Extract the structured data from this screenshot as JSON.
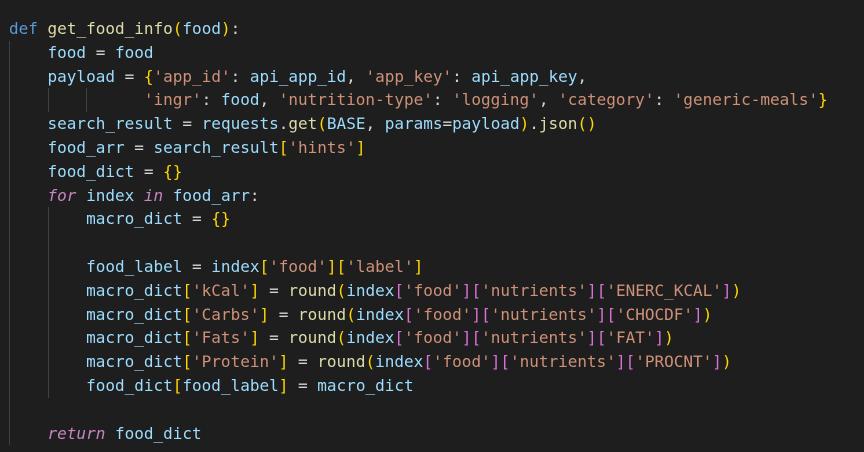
{
  "editor": {
    "theme_colors": {
      "background": "#1e1e1e",
      "keyword": "#569cd6",
      "control_keyword": "#c586c0",
      "function": "#dcdcaa",
      "variable": "#9cdcfe",
      "string": "#ce9178",
      "plain": "#d4d4d4",
      "bracket_level_1": "#ffd700",
      "bracket_level_2": "#da70d6",
      "bracket_level_3": "#179fff",
      "indent_guide": "#404040"
    },
    "lines": [
      {
        "indent": 0,
        "tokens": [
          {
            "t": "def",
            "c": "kw-def"
          },
          {
            "t": " ",
            "c": "pl"
          },
          {
            "t": "get_food_info",
            "c": "fn"
          },
          {
            "t": "(",
            "c": "br1"
          },
          {
            "t": "food",
            "c": "var"
          },
          {
            "t": ")",
            "c": "br1"
          },
          {
            "t": ":",
            "c": "pl"
          }
        ]
      },
      {
        "indent": 1,
        "tokens": [
          {
            "t": "food",
            "c": "var"
          },
          {
            "t": " = ",
            "c": "pl"
          },
          {
            "t": "food",
            "c": "var"
          }
        ]
      },
      {
        "indent": 1,
        "tokens": [
          {
            "t": "payload",
            "c": "var"
          },
          {
            "t": " = ",
            "c": "pl"
          },
          {
            "t": "{",
            "c": "br1"
          },
          {
            "t": "'app_id'",
            "c": "str"
          },
          {
            "t": ": ",
            "c": "pl"
          },
          {
            "t": "api_app_id",
            "c": "var"
          },
          {
            "t": ", ",
            "c": "pl"
          },
          {
            "t": "'app_key'",
            "c": "str"
          },
          {
            "t": ": ",
            "c": "pl"
          },
          {
            "t": "api_app_key",
            "c": "var"
          },
          {
            "t": ",",
            "c": "pl"
          }
        ]
      },
      {
        "indent": 3,
        "pad": "  ",
        "tokens": [
          {
            "t": "'ingr'",
            "c": "str"
          },
          {
            "t": ": ",
            "c": "pl"
          },
          {
            "t": "food",
            "c": "var"
          },
          {
            "t": ", ",
            "c": "pl"
          },
          {
            "t": "'nutrition-type'",
            "c": "str"
          },
          {
            "t": ": ",
            "c": "pl"
          },
          {
            "t": "'logging'",
            "c": "str"
          },
          {
            "t": ", ",
            "c": "pl"
          },
          {
            "t": "'category'",
            "c": "str"
          },
          {
            "t": ": ",
            "c": "pl"
          },
          {
            "t": "'generic-meals'",
            "c": "str"
          },
          {
            "t": "}",
            "c": "br1"
          }
        ]
      },
      {
        "indent": 1,
        "tokens": [
          {
            "t": "search_result",
            "c": "var"
          },
          {
            "t": " = ",
            "c": "pl"
          },
          {
            "t": "requests",
            "c": "var"
          },
          {
            "t": ".",
            "c": "pl"
          },
          {
            "t": "get",
            "c": "fn"
          },
          {
            "t": "(",
            "c": "br1"
          },
          {
            "t": "BASE",
            "c": "var"
          },
          {
            "t": ", ",
            "c": "pl"
          },
          {
            "t": "params",
            "c": "var"
          },
          {
            "t": "=",
            "c": "pl"
          },
          {
            "t": "payload",
            "c": "var"
          },
          {
            "t": ")",
            "c": "br1"
          },
          {
            "t": ".",
            "c": "pl"
          },
          {
            "t": "json",
            "c": "fn"
          },
          {
            "t": "(",
            "c": "br1"
          },
          {
            "t": ")",
            "c": "br1"
          }
        ]
      },
      {
        "indent": 1,
        "tokens": [
          {
            "t": "food_arr",
            "c": "var"
          },
          {
            "t": " = ",
            "c": "pl"
          },
          {
            "t": "search_result",
            "c": "var"
          },
          {
            "t": "[",
            "c": "br1"
          },
          {
            "t": "'hints'",
            "c": "str"
          },
          {
            "t": "]",
            "c": "br1"
          }
        ]
      },
      {
        "indent": 1,
        "tokens": [
          {
            "t": "food_dict",
            "c": "var"
          },
          {
            "t": " = ",
            "c": "pl"
          },
          {
            "t": "{}",
            "c": "br1"
          }
        ]
      },
      {
        "indent": 1,
        "tokens": [
          {
            "t": "for",
            "c": "kw-ctrl"
          },
          {
            "t": " ",
            "c": "pl"
          },
          {
            "t": "index",
            "c": "var"
          },
          {
            "t": " ",
            "c": "pl"
          },
          {
            "t": "in",
            "c": "kw-ctrl"
          },
          {
            "t": " ",
            "c": "pl"
          },
          {
            "t": "food_arr",
            "c": "var"
          },
          {
            "t": ":",
            "c": "pl"
          }
        ]
      },
      {
        "indent": 2,
        "tokens": [
          {
            "t": "macro_dict",
            "c": "var"
          },
          {
            "t": " = ",
            "c": "pl"
          },
          {
            "t": "{}",
            "c": "br1"
          }
        ]
      },
      {
        "indent": 2,
        "tokens": []
      },
      {
        "indent": 2,
        "tokens": [
          {
            "t": "food_label",
            "c": "var"
          },
          {
            "t": " = ",
            "c": "pl"
          },
          {
            "t": "index",
            "c": "var"
          },
          {
            "t": "[",
            "c": "br1"
          },
          {
            "t": "'food'",
            "c": "str"
          },
          {
            "t": "]",
            "c": "br1"
          },
          {
            "t": "[",
            "c": "br1"
          },
          {
            "t": "'label'",
            "c": "str"
          },
          {
            "t": "]",
            "c": "br1"
          }
        ]
      },
      {
        "indent": 2,
        "tokens": [
          {
            "t": "macro_dict",
            "c": "var"
          },
          {
            "t": "[",
            "c": "br1"
          },
          {
            "t": "'kCal'",
            "c": "str"
          },
          {
            "t": "]",
            "c": "br1"
          },
          {
            "t": " = ",
            "c": "pl"
          },
          {
            "t": "round",
            "c": "fn"
          },
          {
            "t": "(",
            "c": "br1"
          },
          {
            "t": "index",
            "c": "var"
          },
          {
            "t": "[",
            "c": "br2"
          },
          {
            "t": "'food'",
            "c": "str"
          },
          {
            "t": "]",
            "c": "br2"
          },
          {
            "t": "[",
            "c": "br2"
          },
          {
            "t": "'nutrients'",
            "c": "str"
          },
          {
            "t": "]",
            "c": "br2"
          },
          {
            "t": "[",
            "c": "br2"
          },
          {
            "t": "'ENERC_KCAL'",
            "c": "str"
          },
          {
            "t": "]",
            "c": "br2"
          },
          {
            "t": ")",
            "c": "br1"
          }
        ]
      },
      {
        "indent": 2,
        "tokens": [
          {
            "t": "macro_dict",
            "c": "var"
          },
          {
            "t": "[",
            "c": "br1"
          },
          {
            "t": "'Carbs'",
            "c": "str"
          },
          {
            "t": "]",
            "c": "br1"
          },
          {
            "t": " = ",
            "c": "pl"
          },
          {
            "t": "round",
            "c": "fn"
          },
          {
            "t": "(",
            "c": "br1"
          },
          {
            "t": "index",
            "c": "var"
          },
          {
            "t": "[",
            "c": "br2"
          },
          {
            "t": "'food'",
            "c": "str"
          },
          {
            "t": "]",
            "c": "br2"
          },
          {
            "t": "[",
            "c": "br2"
          },
          {
            "t": "'nutrients'",
            "c": "str"
          },
          {
            "t": "]",
            "c": "br2"
          },
          {
            "t": "[",
            "c": "br2"
          },
          {
            "t": "'CHOCDF'",
            "c": "str"
          },
          {
            "t": "]",
            "c": "br2"
          },
          {
            "t": ")",
            "c": "br1"
          }
        ]
      },
      {
        "indent": 2,
        "tokens": [
          {
            "t": "macro_dict",
            "c": "var"
          },
          {
            "t": "[",
            "c": "br1"
          },
          {
            "t": "'Fats'",
            "c": "str"
          },
          {
            "t": "]",
            "c": "br1"
          },
          {
            "t": " = ",
            "c": "pl"
          },
          {
            "t": "round",
            "c": "fn"
          },
          {
            "t": "(",
            "c": "br1"
          },
          {
            "t": "index",
            "c": "var"
          },
          {
            "t": "[",
            "c": "br2"
          },
          {
            "t": "'food'",
            "c": "str"
          },
          {
            "t": "]",
            "c": "br2"
          },
          {
            "t": "[",
            "c": "br2"
          },
          {
            "t": "'nutrients'",
            "c": "str"
          },
          {
            "t": "]",
            "c": "br2"
          },
          {
            "t": "[",
            "c": "br2"
          },
          {
            "t": "'FAT'",
            "c": "str"
          },
          {
            "t": "]",
            "c": "br2"
          },
          {
            "t": ")",
            "c": "br1"
          }
        ]
      },
      {
        "indent": 2,
        "tokens": [
          {
            "t": "macro_dict",
            "c": "var"
          },
          {
            "t": "[",
            "c": "br1"
          },
          {
            "t": "'Protein'",
            "c": "str"
          },
          {
            "t": "]",
            "c": "br1"
          },
          {
            "t": " = ",
            "c": "pl"
          },
          {
            "t": "round",
            "c": "fn"
          },
          {
            "t": "(",
            "c": "br1"
          },
          {
            "t": "index",
            "c": "var"
          },
          {
            "t": "[",
            "c": "br2"
          },
          {
            "t": "'food'",
            "c": "str"
          },
          {
            "t": "]",
            "c": "br2"
          },
          {
            "t": "[",
            "c": "br2"
          },
          {
            "t": "'nutrients'",
            "c": "str"
          },
          {
            "t": "]",
            "c": "br2"
          },
          {
            "t": "[",
            "c": "br2"
          },
          {
            "t": "'PROCNT'",
            "c": "str"
          },
          {
            "t": "]",
            "c": "br2"
          },
          {
            "t": ")",
            "c": "br1"
          }
        ]
      },
      {
        "indent": 2,
        "tokens": [
          {
            "t": "food_dict",
            "c": "var"
          },
          {
            "t": "[",
            "c": "br1"
          },
          {
            "t": "food_label",
            "c": "var"
          },
          {
            "t": "]",
            "c": "br1"
          },
          {
            "t": " = ",
            "c": "pl"
          },
          {
            "t": "macro_dict",
            "c": "var"
          }
        ]
      },
      {
        "indent": 1,
        "tokens": []
      },
      {
        "indent": 1,
        "tokens": [
          {
            "t": "return",
            "c": "kw-ctrl"
          },
          {
            "t": " ",
            "c": "pl"
          },
          {
            "t": "food_dict",
            "c": "var"
          }
        ]
      }
    ]
  }
}
